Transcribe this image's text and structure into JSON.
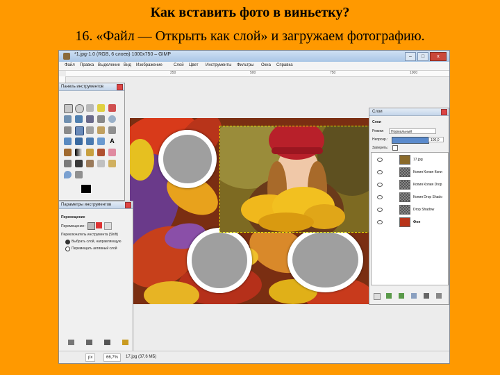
{
  "slide": {
    "title": "Как вставить фото в виньетку?",
    "subtitle": "16. «Файл — Открыть как слой» и загружаем фотографию."
  },
  "window": {
    "title": "*1.jpg-1.0 (RGB, 6 слоев) 1000x750 – GIMP",
    "controls": [
      "–",
      "□",
      "x"
    ]
  },
  "menu": [
    "Файл",
    "Правка",
    "Выделение",
    "Вид",
    "Изображение",
    "Слой",
    "Цвет",
    "Инструменты",
    "Фильтры",
    "Окна",
    "Справка"
  ],
  "ruler": [
    "250",
    "500",
    "750",
    "1000"
  ],
  "toolbox": {
    "title": "Панель инструментов"
  },
  "tool_options": {
    "title": "Параметры инструментов",
    "tool_name": "Перемещение",
    "move_label": "Перемещение:",
    "switch_label": "Переключатель инструмента (Shift)",
    "option1": "Выбрать слой, направляющую",
    "option2": "Перемещать активный слой"
  },
  "layers": {
    "title": "Слои",
    "section": "Слои",
    "mode_label": "Режим:",
    "mode_value": "Нормальный",
    "opacity_label": "Непрозр.:",
    "opacity_value": "100,0",
    "lock_label": "Запереть:",
    "items": [
      {
        "name": "17.jpg",
        "thumb": "photo"
      },
      {
        "name": "Копия Копия Копи",
        "thumb": "checker"
      },
      {
        "name": "Копия Копия Drop",
        "thumb": "checker"
      },
      {
        "name": "Копия Drop Shado",
        "thumb": "checker"
      },
      {
        "name": "Drop Shadow",
        "thumb": "checker"
      },
      {
        "name": "Фон",
        "thumb": "leaves"
      }
    ]
  },
  "statusbar": {
    "unit": "px",
    "zoom": "66,7%",
    "info": "17.jpg (37,6 МБ)"
  }
}
